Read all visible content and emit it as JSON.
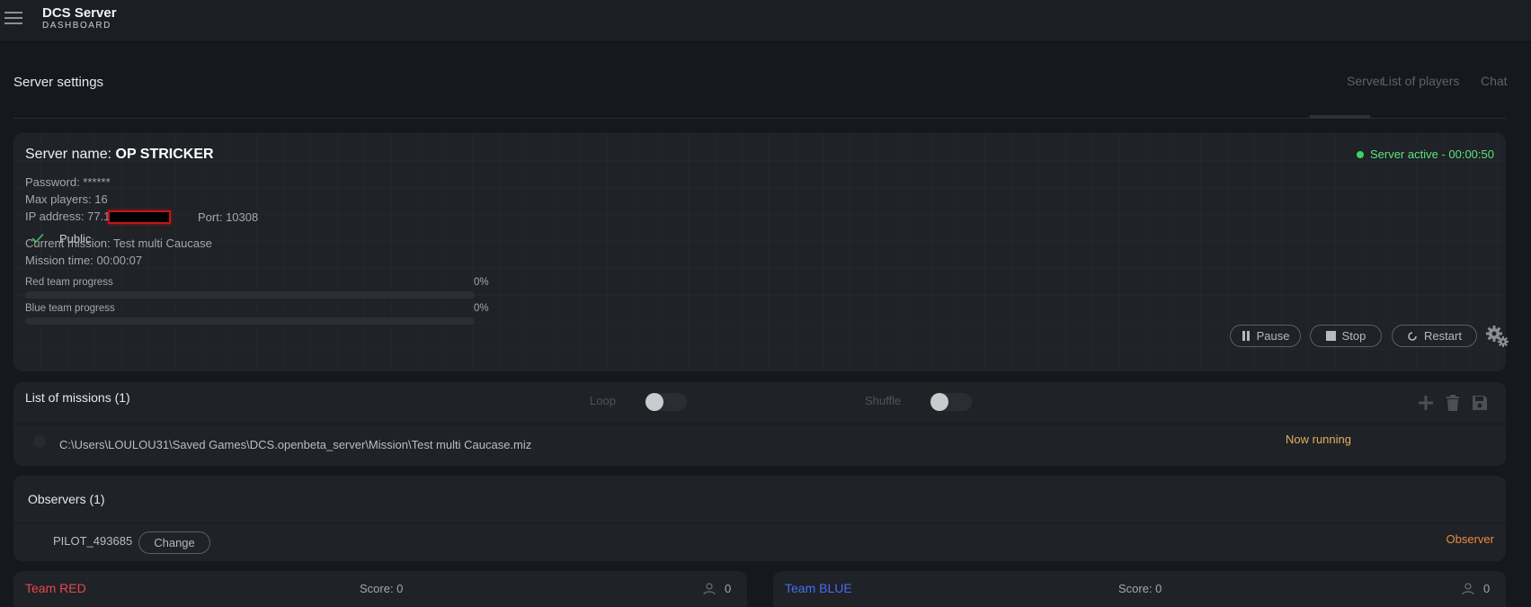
{
  "app": {
    "title": "DCS Server",
    "subtitle": "DASHBOARD"
  },
  "header": {
    "title": "Server settings",
    "tabs": [
      {
        "label": "Server",
        "active": true
      },
      {
        "label": "List of players",
        "active": false
      },
      {
        "label": "Chat",
        "active": false
      }
    ]
  },
  "server": {
    "name_label": "Server name:",
    "name": "OP STRICKER",
    "status": "Server active - 00:00:50",
    "status_color": "#5ee27f",
    "password": "Password: ******",
    "max_players": "Max players: 16",
    "ip": "IP address: 77.1",
    "port": "Port: 10308",
    "public_label": "Public",
    "public_checked": true,
    "mission": "Current mission: Test multi Caucase",
    "mission_time": "Mission time: 00:00:07",
    "red_progress_label": "Red team progress",
    "red_progress_pct": "0%",
    "red_progress": 0,
    "blue_progress_label": "Blue team progress",
    "blue_progress_pct": "0%",
    "blue_progress": 0,
    "pause_label": "Pause",
    "stop_label": "Stop",
    "restart_label": "Restart"
  },
  "missions": {
    "title": "List of missions (1)",
    "loop_label": "Loop",
    "shuffle_label": "Shuffle",
    "loop_on": false,
    "shuffle_on": false,
    "items": [
      {
        "path": "C:\\Users\\LOULOU31\\Saved Games\\DCS.openbeta_server\\Mission\\Test multi Caucase.miz",
        "status": "Now running"
      }
    ]
  },
  "observers": {
    "title": "Observers (1)",
    "items": [
      {
        "name": "PILOT_493685",
        "change_label": "Change",
        "role": "Observer"
      }
    ]
  },
  "teams": {
    "red": {
      "name": "Team RED",
      "score": "Score: 0",
      "count": "0",
      "color": "#e5484d"
    },
    "blue": {
      "name": "Team BLUE",
      "score": "Score: 0",
      "count": "0",
      "color": "#4a6cf0"
    }
  },
  "icons": [
    "menu-icon",
    "check-icon",
    "pause-icon",
    "stop-icon",
    "restart-icon",
    "gears-icon",
    "plus-icon",
    "trash-icon",
    "save-icon",
    "user-icon"
  ]
}
